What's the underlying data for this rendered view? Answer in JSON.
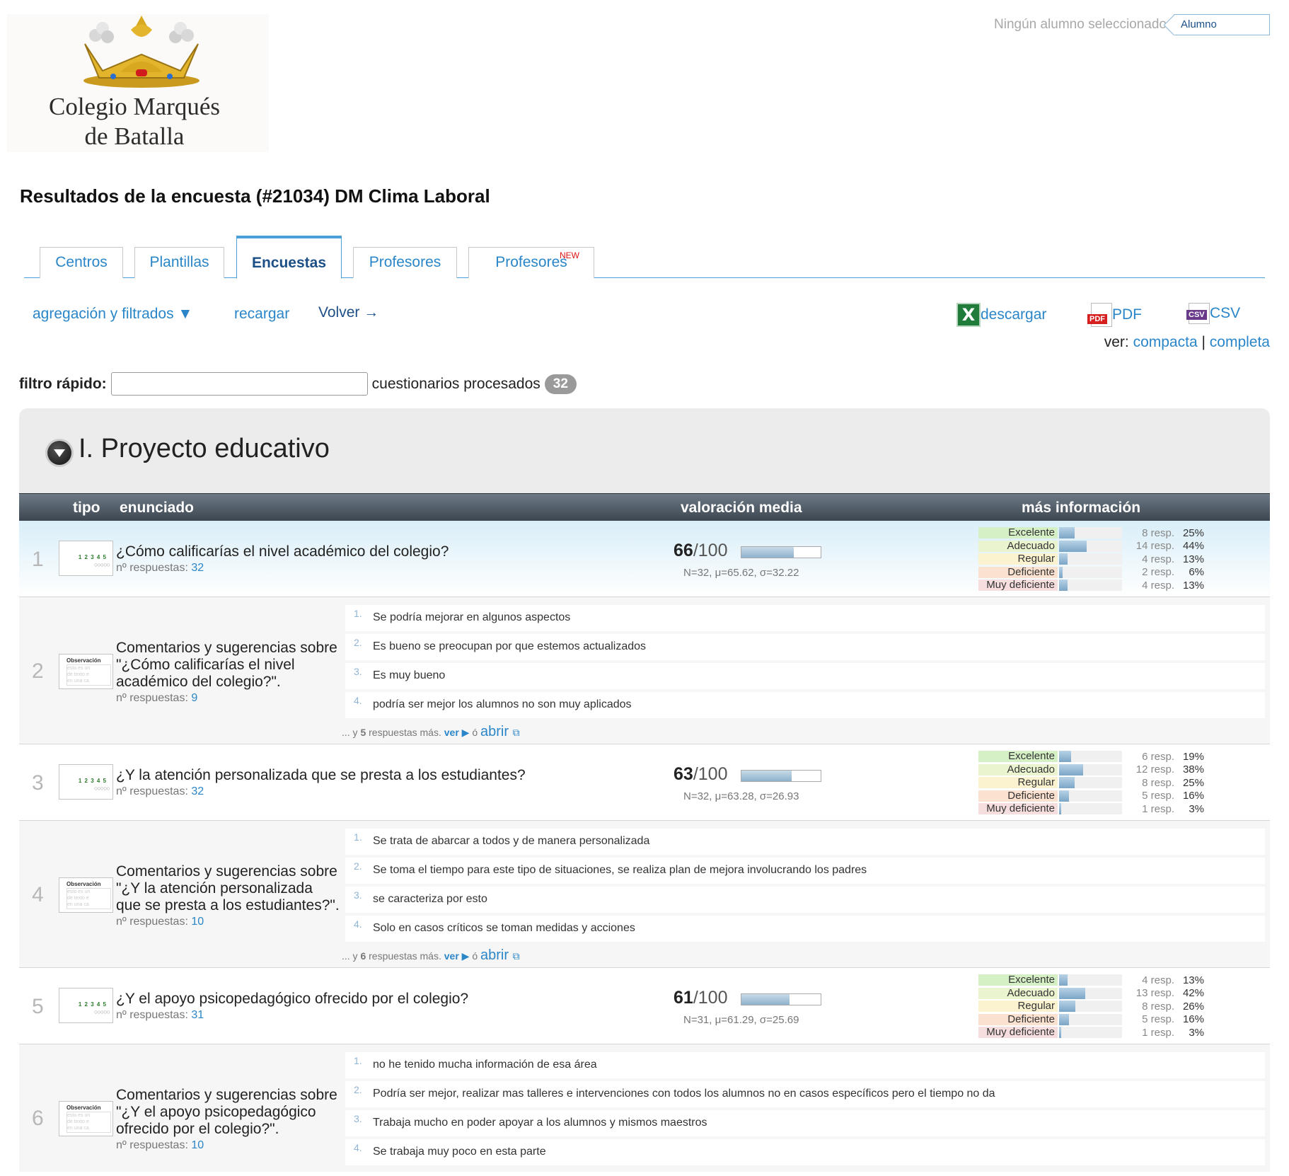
{
  "logo": {
    "name_line1": "Colegio Marqués",
    "name_line2": "de Batalla"
  },
  "student": {
    "none_text": "Ningún alumno seleccionado",
    "field_value": "Alumno"
  },
  "title": "Resultados de la encuesta (#21034) DM Clima Laboral",
  "tabs": [
    {
      "label": "Centros"
    },
    {
      "label": "Plantillas"
    },
    {
      "label": "Encuestas",
      "active": true
    },
    {
      "label": "Profesores"
    },
    {
      "label": "Profesores",
      "badge": "NEW"
    }
  ],
  "toolbar": {
    "aggregation": "agregación y filtrados ▼",
    "reload": "recargar",
    "back": "Volver →",
    "download": "descargar",
    "pdf": "PDF",
    "csv": "CSV",
    "view_label": "ver:",
    "view_compact": "compacta",
    "view_sep": "|",
    "view_full": "completa"
  },
  "filter": {
    "label": "filtro rápido:",
    "value": "",
    "processed_label": "cuestionarios procesados",
    "processed_count": "32"
  },
  "section": {
    "title": "I. Proyecto educativo"
  },
  "table_headers": {
    "tipo": "tipo",
    "enunciado": "enunciado",
    "valoracion": "valoración media",
    "info": "más información"
  },
  "resp_label": "nº respuestas:",
  "more": {
    "prefix": "... y",
    "suffix": "respuestas más.",
    "ver": "ver ▶",
    "or": "ó",
    "abrir": "abrir"
  },
  "dist_labels": [
    "Excelente",
    "Adecuado",
    "Regular",
    "Deficiente",
    "Muy deficiente"
  ],
  "dist_colors": [
    "#d6f0c6",
    "#eaf5d0",
    "#fbf3cf",
    "#fbe1cf",
    "#f6dede"
  ],
  "rows": [
    {
      "num": "1",
      "question": "¿Cómo calificarías el nivel académico del colegio?",
      "responses": "32",
      "score": "66",
      "score_of": "/100",
      "score_fraction": 0.66,
      "stats": "N=32, μ=65.62, σ=32.22",
      "dist": [
        {
          "count": "8 resp.",
          "pct": "25%",
          "fraction": 0.25
        },
        {
          "count": "14 resp.",
          "pct": "44%",
          "fraction": 0.44
        },
        {
          "count": "4 resp.",
          "pct": "13%",
          "fraction": 0.13
        },
        {
          "count": "2 resp.",
          "pct": "6%",
          "fraction": 0.06
        },
        {
          "count": "4 resp.",
          "pct": "13%",
          "fraction": 0.13
        }
      ]
    },
    {
      "num": "2",
      "question_line1": "Comentarios y sugerencias sobre",
      "question_line2": "\"¿Cómo calificarías el nivel",
      "question_line3": "académico del colegio?\".",
      "responses": "9",
      "comments": [
        "Se podría mejorar en algunos aspectos",
        "Es bueno se preocupan por que estemos actualizados",
        "Es muy bueno",
        "podría ser mejor los alumnos no son muy aplicados"
      ],
      "more_count": "5"
    },
    {
      "num": "3",
      "question": "¿Y la atención personalizada que se presta a los estudiantes?",
      "responses": "32",
      "score": "63",
      "score_of": "/100",
      "score_fraction": 0.63,
      "stats": "N=32, μ=63.28, σ=26.93",
      "dist": [
        {
          "count": "6 resp.",
          "pct": "19%",
          "fraction": 0.19
        },
        {
          "count": "12 resp.",
          "pct": "38%",
          "fraction": 0.38
        },
        {
          "count": "8 resp.",
          "pct": "25%",
          "fraction": 0.25
        },
        {
          "count": "5 resp.",
          "pct": "16%",
          "fraction": 0.16
        },
        {
          "count": "1 resp.",
          "pct": "3%",
          "fraction": 0.03
        }
      ]
    },
    {
      "num": "4",
      "question_line1": "Comentarios y sugerencias sobre",
      "question_line2": "\"¿Y la atención personalizada",
      "question_line3": "que se presta a los estudiantes?\".",
      "responses": "10",
      "comments": [
        "Se trata de abarcar a todos y de manera personalizada",
        "Se toma el tiempo para este tipo de situaciones, se realiza plan de mejora involucrando los padres",
        "se caracteriza por esto",
        "Solo en casos críticos se toman medidas y acciones"
      ],
      "more_count": "6"
    },
    {
      "num": "5",
      "question": "¿Y el apoyo psicopedagógico ofrecido por el colegio?",
      "responses": "31",
      "score": "61",
      "score_of": "/100",
      "score_fraction": 0.61,
      "stats": "N=31, μ=61.29, σ=25.69",
      "dist": [
        {
          "count": "4 resp.",
          "pct": "13%",
          "fraction": 0.13
        },
        {
          "count": "13 resp.",
          "pct": "42%",
          "fraction": 0.42
        },
        {
          "count": "8 resp.",
          "pct": "26%",
          "fraction": 0.26
        },
        {
          "count": "5 resp.",
          "pct": "16%",
          "fraction": 0.16
        },
        {
          "count": "1 resp.",
          "pct": "3%",
          "fraction": 0.03
        }
      ]
    },
    {
      "num": "6",
      "question_line1": "Comentarios y sugerencias sobre",
      "question_line2": "\"¿Y el apoyo psicopedagógico",
      "question_line3": "ofrecido por el colegio?\".",
      "responses": "10",
      "comments": [
        "no he tenido mucha información de esa área",
        "Podría ser mejor, realizar mas talleres e intervenciones con todos los alumnos no en casos específicos pero el tiempo no da",
        "Trabaja mucho en poder apoyar a los alumnos y mismos maestros",
        "Se trabaja muy poco en esta parte"
      ]
    }
  ]
}
